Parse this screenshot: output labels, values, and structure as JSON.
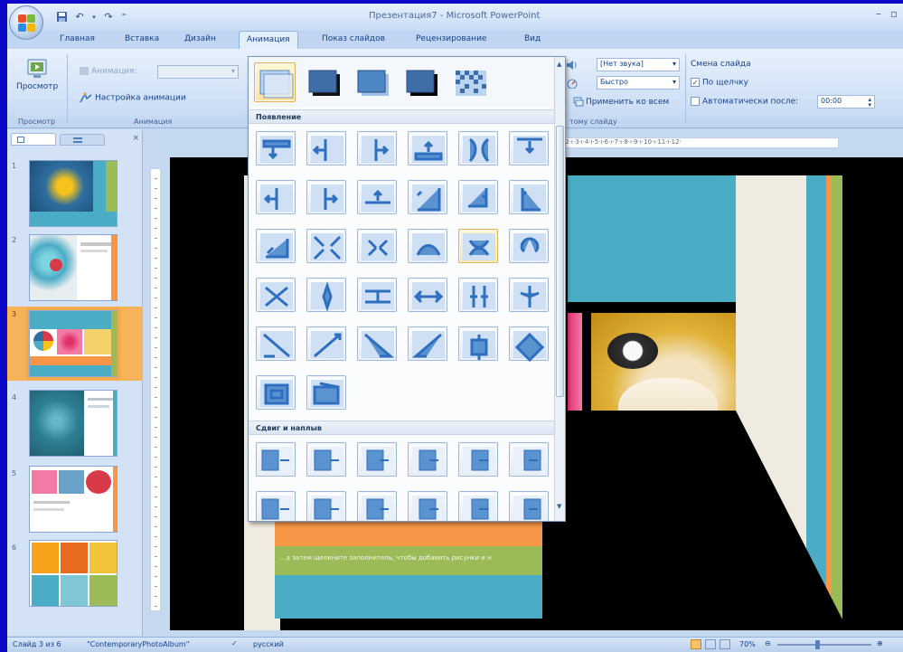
{
  "window": {
    "title": "Презентация7 - Microsoft PowerPoint"
  },
  "qat": {
    "save_icon": "save-icon",
    "undo_icon": "undo-icon",
    "redo_icon": "redo-icon"
  },
  "tabs": [
    {
      "label": "Главная"
    },
    {
      "label": "Вставка"
    },
    {
      "label": "Дизайн"
    },
    {
      "label": "Анимация",
      "active": true
    },
    {
      "label": "Показ слайдов"
    },
    {
      "label": "Рецензирование"
    },
    {
      "label": "Вид"
    }
  ],
  "ribbon": {
    "preview": {
      "label": "Просмотр",
      "group": "Просмотр"
    },
    "animation": {
      "combo_label": "Анимация:",
      "custom_label": "Настройка анимации",
      "group": "Анимация"
    },
    "transition": {
      "sound_value": "[Нет звука]",
      "speed_value": "Быстро",
      "apply_all_label": "Применить ко всем",
      "group": "тому слайду"
    },
    "advance": {
      "title": "Смена слайда",
      "on_click_label": "По щелчку",
      "auto_label": "Автоматически после:",
      "auto_value": "00:00"
    }
  },
  "gallery": {
    "section1": "Появление",
    "section2": "Сдвиг и наплыв"
  },
  "ruler": {
    "horizontal": "·2·ı·3·ı·4·ı·5·ı·6·ı·7·ı·8·ı·9·ı·10·ı·11·ı·12·"
  },
  "slide": {
    "caption": "...а затем щелкните заполнитель, чтобы добавить рисунки и н"
  },
  "status": {
    "slide_info": "Слайд 3 из 6",
    "theme": "\"ContemporaryPhotoAlbum\"",
    "language": "русский",
    "zoom": "70%"
  },
  "thumbnails": [
    "1",
    "2",
    "3",
    "4",
    "5",
    "6"
  ],
  "colors": {
    "ribbon_text": "#15428b",
    "desktop": "#0b08c8",
    "slide_teal": "#4bacc6",
    "slide_orange": "#f79646",
    "slide_green": "#9bbb59",
    "slide_cream": "#f0ebe0"
  }
}
